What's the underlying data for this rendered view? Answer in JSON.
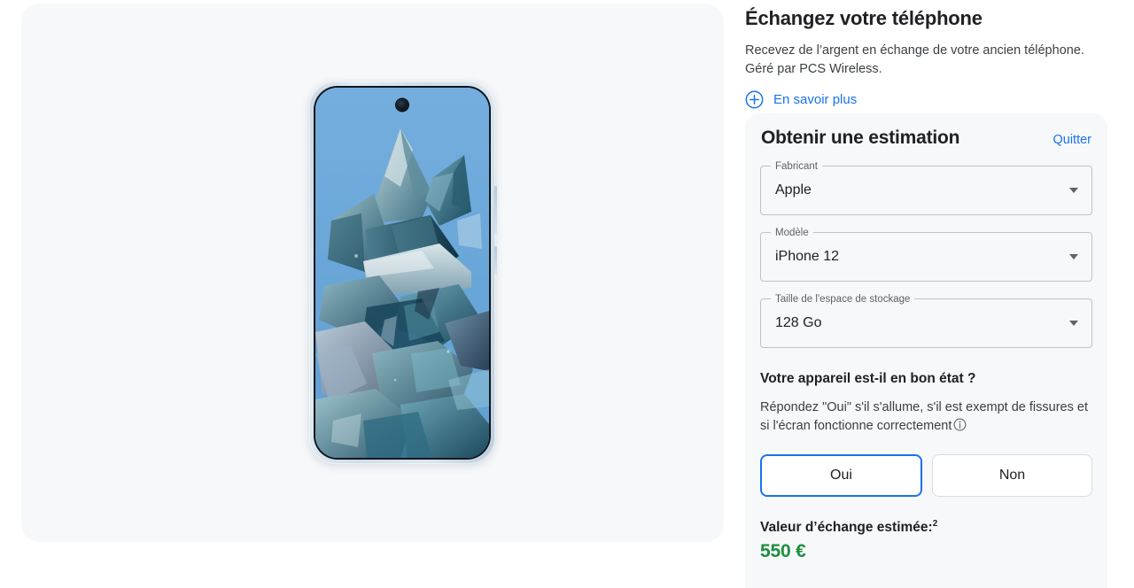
{
  "tradein": {
    "headline": "Échangez votre téléphone",
    "subtitle": "Recevez de l’argent en échange de votre ancien téléphone. Géré par PCS Wireless.",
    "learn_more_label": "En savoir plus",
    "learn_more_icon": "plus-circle-icon"
  },
  "estimate": {
    "title": "Obtenir une estimation",
    "quit_label": "Quitter",
    "fields": [
      {
        "label": "Fabricant",
        "value": "Apple",
        "icon": "chevron-down-icon"
      },
      {
        "label": "Modèle",
        "value": "iPhone 12",
        "icon": "chevron-down-icon"
      },
      {
        "label": "Taille de l'espace de stockage",
        "value": "128 Go",
        "icon": "chevron-down-icon"
      }
    ],
    "condition_question": "Votre appareil est-il en bon état ?",
    "condition_hint": "Répondez \"Oui\" s'il s'allume, s'il est exempt de fissures et si l'écran fonctionne correctement",
    "condition_info_icon": "info-circle-icon",
    "choices": [
      {
        "label": "Oui",
        "selected": true
      },
      {
        "label": "Non",
        "selected": false
      }
    ],
    "value_label": "Valeur d’échange estimée:",
    "value_footnote": "2",
    "value_amount": "550 €"
  },
  "product_image": {
    "alt": "phone-front-view",
    "wallpaper": "blue crystal / ice shards",
    "camera": "punch-hole-camera"
  },
  "colors": {
    "accent_blue": "#1a73e8",
    "value_green": "#1e8e3e",
    "panel_bg": "#f6f8fa",
    "text_primary": "#202124",
    "text_secondary": "#3c4043"
  }
}
